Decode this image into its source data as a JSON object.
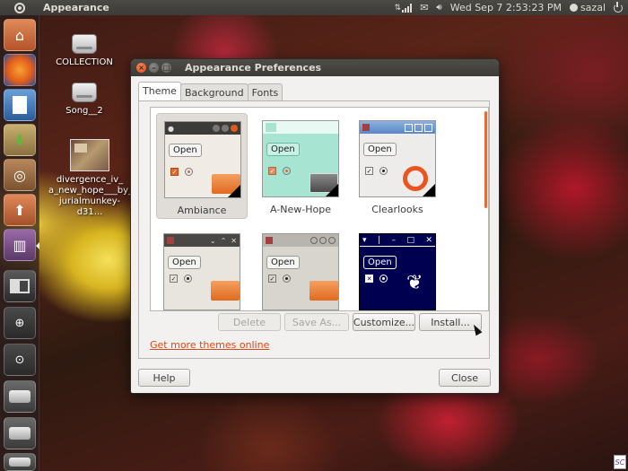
{
  "top_panel": {
    "app_title": "Appearance",
    "datetime": "Wed Sep  7  2:53:23 PM",
    "username": "sazal"
  },
  "launcher": {
    "items": [
      {
        "name": "home-folder",
        "icon": "folder-home-icon"
      },
      {
        "name": "firefox",
        "icon": "firefox-icon"
      },
      {
        "name": "libreoffice-writer",
        "icon": "document-icon"
      },
      {
        "name": "software-updates",
        "icon": "download-icon"
      },
      {
        "name": "ubuntu-software-center",
        "icon": "software-center-icon"
      },
      {
        "name": "downloads",
        "icon": "folder-upload-icon"
      },
      {
        "name": "appearance",
        "icon": "appearance-icon"
      },
      {
        "name": "workspaces",
        "icon": "workspace-switcher-icon"
      },
      {
        "name": "applications",
        "icon": "magnifier-icon"
      },
      {
        "name": "files-folders",
        "icon": "search-files-icon"
      },
      {
        "name": "drive-1",
        "icon": "drive-icon"
      },
      {
        "name": "drive-2",
        "icon": "drive-icon"
      },
      {
        "name": "trash",
        "icon": "drive-icon"
      }
    ]
  },
  "desktop": {
    "icons": [
      {
        "label": "COLLECTION"
      },
      {
        "label": "Song__2"
      },
      {
        "label": "divergence_iv_ a_new_hope___by_ jurialmunkey-d31..."
      }
    ]
  },
  "dialog": {
    "title": "Appearance Preferences",
    "tabs": [
      "Theme",
      "Background",
      "Fonts"
    ],
    "themes": [
      {
        "name": "Ambiance",
        "selected": true
      },
      {
        "name": "A-New-Hope",
        "selected": false
      },
      {
        "name": "Clearlooks",
        "selected": false
      },
      {
        "name": "",
        "selected": false
      },
      {
        "name": "",
        "selected": false
      },
      {
        "name": "",
        "selected": false
      }
    ],
    "preview_open_label": "Open",
    "buttons": {
      "delete": "Delete",
      "save_as": "Save As...",
      "customize": "Customize...",
      "install": "Install...",
      "help": "Help",
      "close": "Close"
    },
    "link": "Get more themes online"
  },
  "colors": {
    "accent": "#dd4814",
    "panel": "#3c3b37",
    "close_button": "#df4a14"
  }
}
